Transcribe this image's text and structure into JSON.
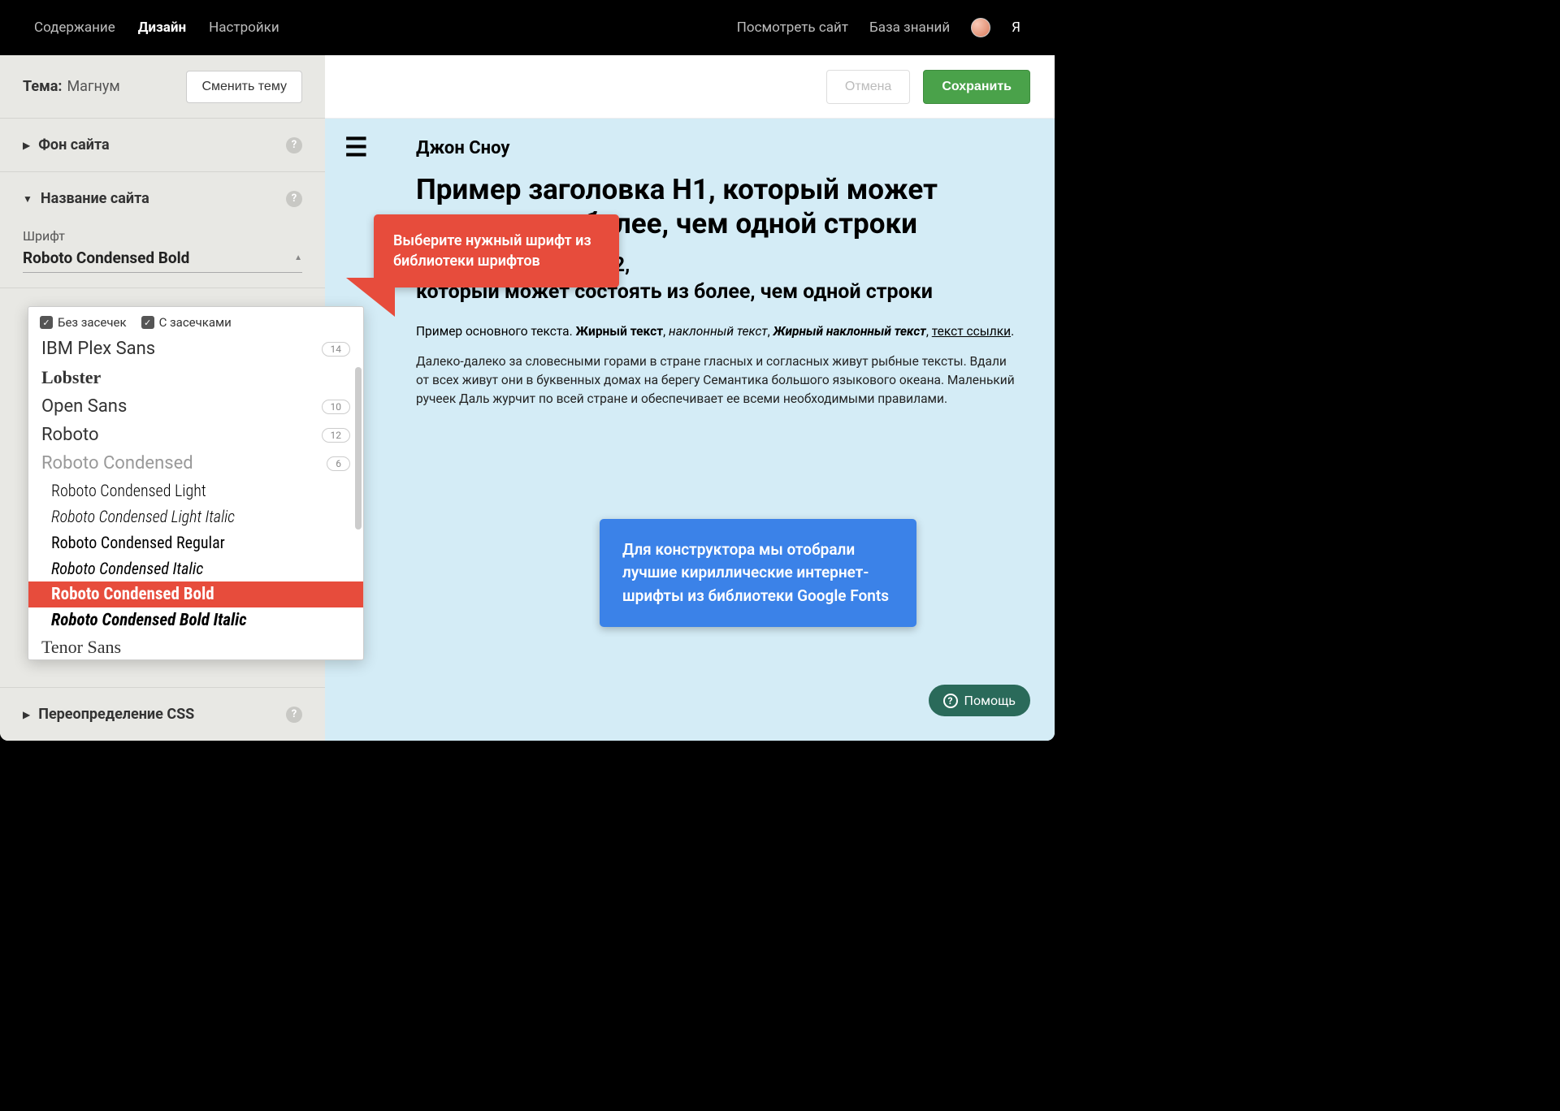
{
  "topnav": {
    "content": "Содержание",
    "design": "Дизайн",
    "settings": "Настройки",
    "view_site": "Посмотреть сайт",
    "kb": "База знаний",
    "user_letter": "Я"
  },
  "sidebar": {
    "theme_label": "Тема:",
    "theme_name": "Магнум",
    "change_theme": "Сменить тему",
    "sections": {
      "bg": "Фон сайта",
      "site_name": "Название сайта",
      "css": "Переопределение CSS"
    },
    "font_field_label": "Шрифт",
    "font_selected": "Roboto Condensed Bold"
  },
  "content_bar": {
    "cancel": "Отмена",
    "save": "Сохранить"
  },
  "preview": {
    "site_title": "Джон Сноу",
    "h1": "Пример заголовка H1, который может состоять из более, чем одной строки",
    "h2_a": "Пример заголовка H2,",
    "h2_b": "который может состоять из более, чем одной строки",
    "body_prefix": "Пример основного текста.",
    "bold": "Жирный текст",
    "italic": "наклонный текст",
    "bold_italic": "Жирный наклонный текст",
    "link": "текст ссылки",
    "sep": ", ",
    "dot": ".",
    "lorem": "Далеко-далеко за словесными горами в стране гласных и согласных живут рыбные тексты. Вдали от всех живут они в буквенных домах на берегу Семантика большого языкового океана. Маленький ручеек Даль журчит по всей стране и обеспечивает ее всеми необходимыми правилами."
  },
  "font_dropdown": {
    "filter_sans": "Без засечек",
    "filter_serif": "С засечками",
    "items": {
      "ibm": "IBM Plex Sans",
      "ibm_badge": "14",
      "lobster": "Lobster",
      "open_sans": "Open Sans",
      "open_sans_badge": "10",
      "roboto": "Roboto",
      "roboto_badge": "12",
      "roboto_condensed": "Roboto Condensed",
      "roboto_condensed_badge": "6",
      "rc_light": "Roboto Condensed Light",
      "rc_light_italic": "Roboto Condensed Light Italic",
      "rc_regular": "Roboto Condensed Regular",
      "rc_italic": "Roboto Condensed Italic",
      "rc_bold": "Roboto Condensed Bold",
      "rc_bold_italic": "Roboto Condensed Bold Italic",
      "tenor": "Tenor Sans"
    }
  },
  "callouts": {
    "red": "Выберите нужный шрифт из библиотеки шрифтов",
    "blue": "Для конструктора мы отобрали лучшие кириллические интернет-шрифты из библиотеки Google Fonts"
  },
  "help_btn": "Помощь"
}
